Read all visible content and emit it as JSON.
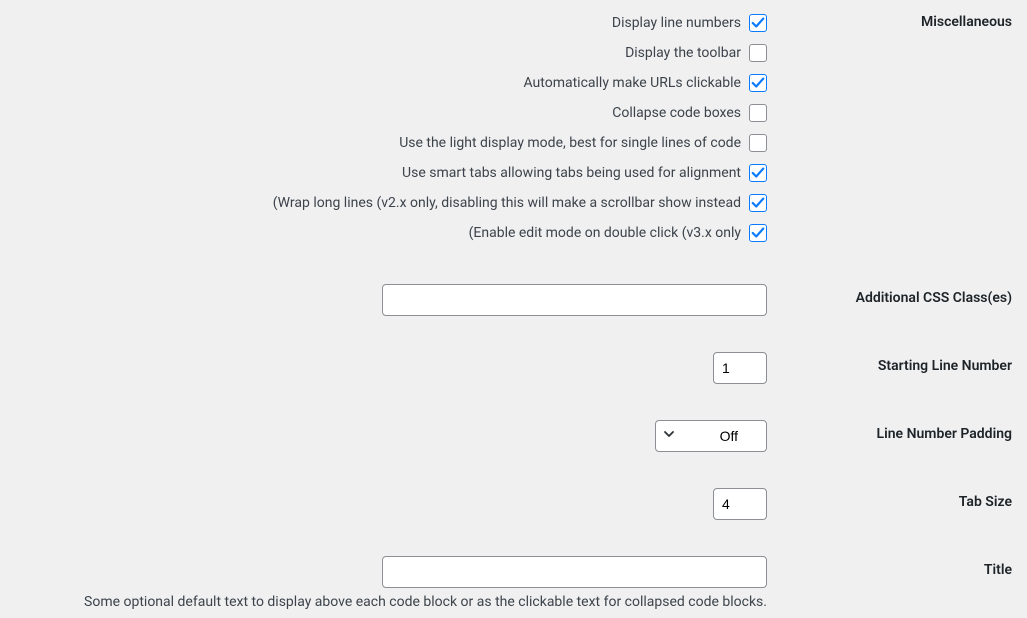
{
  "sections": {
    "miscellaneous": {
      "heading": "Miscellaneous",
      "display_line_numbers": {
        "label": "Display line numbers",
        "checked": true
      },
      "display_toolbar": {
        "label": "Display the toolbar",
        "checked": false
      },
      "urls_clickable": {
        "label": "Automatically make URLs clickable",
        "checked": true
      },
      "collapse_code": {
        "label": "Collapse code boxes",
        "checked": false
      },
      "light_mode": {
        "label": "Use the light display mode, best for single lines of code",
        "checked": false
      },
      "smart_tabs": {
        "label": "Use smart tabs allowing tabs being used for alignment",
        "checked": true
      },
      "wrap_lines": {
        "label": "(Wrap long lines (v2.x only, disabling this will make a scrollbar show instead",
        "checked": true
      },
      "edit_mode": {
        "label": "(Enable edit mode on double click (v3.x only",
        "checked": true
      }
    },
    "css_classes": {
      "heading": "Additional CSS Class(es)",
      "value": ""
    },
    "starting_line": {
      "heading": "Starting Line Number",
      "value": "1"
    },
    "line_padding": {
      "heading": "Line Number Padding",
      "value": "Off"
    },
    "tab_size": {
      "heading": "Tab Size",
      "value": "4"
    },
    "title": {
      "heading": "Title",
      "value": "",
      "description": ".Some optional default text to display above each code block or as the clickable text for collapsed code blocks"
    }
  }
}
